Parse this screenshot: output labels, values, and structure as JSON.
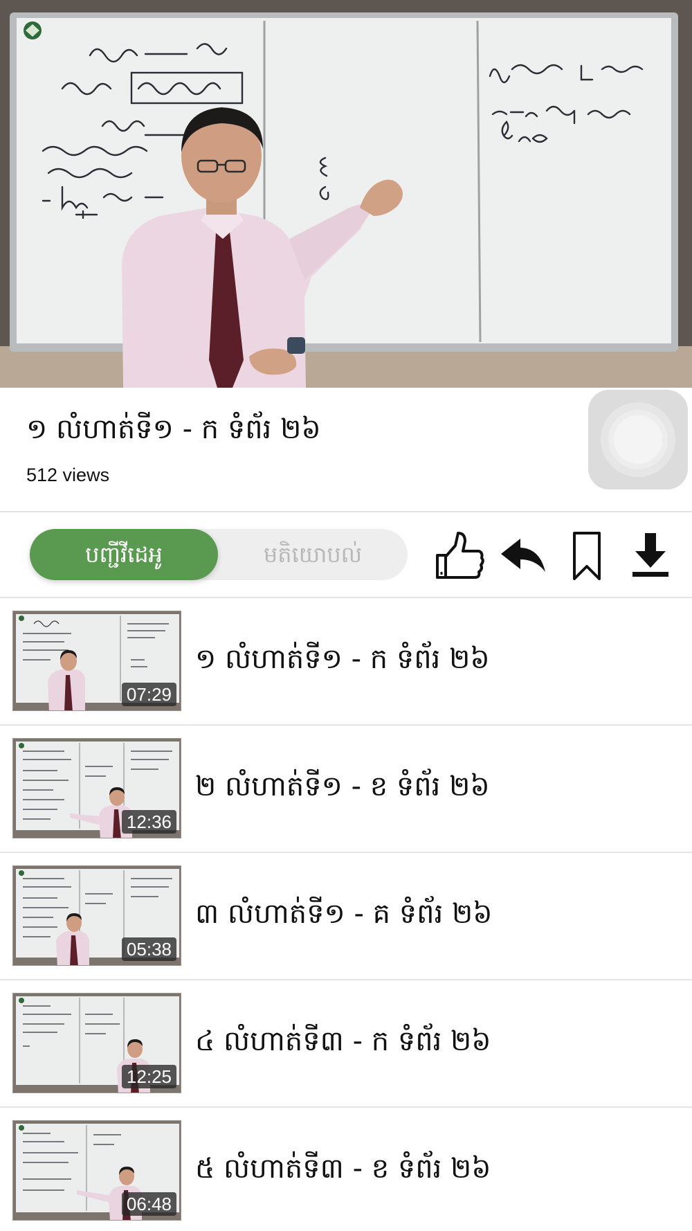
{
  "video": {
    "title": "១ លំហាត់ទី១ - ក ទំព័រ ២៦",
    "views": "512 views"
  },
  "tabs": {
    "active_label": "បញ្ជីវីដេអូ",
    "inactive_label": "មតិយោបល់"
  },
  "actions": [
    {
      "name": "like",
      "icon": "thumbs-up-icon"
    },
    {
      "name": "share",
      "icon": "reply-arrow-icon"
    },
    {
      "name": "bookmark",
      "icon": "bookmark-icon"
    },
    {
      "name": "download",
      "icon": "download-icon"
    }
  ],
  "playlist": [
    {
      "title": "១ លំហាត់ទី១ - ក ទំព័រ ២៦",
      "duration": "07:29"
    },
    {
      "title": "២ លំហាត់ទី១ - ខ ទំព័រ ២៦",
      "duration": "12:36"
    },
    {
      "title": "៣ លំហាត់ទី១ - គ ទំព័រ ២៦",
      "duration": "05:38"
    },
    {
      "title": "៤ លំហាត់ទី៣ - ក ទំព័រ ២៦",
      "duration": "12:25"
    },
    {
      "title": "៥ លំហាត់ទី៣ - ខ ទំព័រ ២៦",
      "duration": "06:48"
    }
  ],
  "colors": {
    "accent_green": "#5a9a50",
    "divider": "#e3e3e3"
  }
}
